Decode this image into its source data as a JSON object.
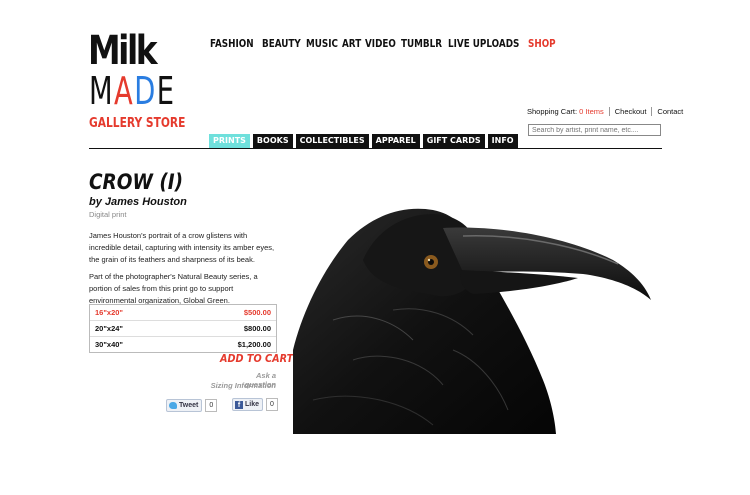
{
  "logo": {
    "line1": "Milk",
    "line2_parts": [
      "M",
      "A",
      "D",
      "E"
    ],
    "subtitle": "GALLERY STORE",
    "colors": {
      "red": "#e53a2d",
      "blue": "#2a7de1"
    }
  },
  "top_nav": {
    "items": [
      {
        "label": "FASHION"
      },
      {
        "label": "BEAUTY"
      },
      {
        "label": "MUSIC"
      },
      {
        "label": "ART"
      },
      {
        "label": "VIDEO"
      },
      {
        "label": "TUMBLR"
      },
      {
        "label": "LIVE UPLOADS"
      },
      {
        "label": "SHOP"
      }
    ],
    "active_index": 7
  },
  "utility": {
    "cart_label": "Shopping Cart:",
    "cart_count": "0 Items",
    "checkout": "Checkout",
    "contact": "Contact"
  },
  "search": {
    "placeholder": "Search by artist, print name, etc...."
  },
  "sub_tabs": {
    "items": [
      "PRINTS",
      "BOOKS",
      "COLLECTIBLES",
      "APPAREL",
      "GIFT CARDS",
      "INFO"
    ],
    "active_index": 0,
    "active_color": "#6fe0dc"
  },
  "product": {
    "title": "CROW (I)",
    "artist": "by James Houston",
    "medium": "Digital print",
    "description_1": "James Houston's portrait of a crow glistens with incredible detail, capturing with intensity its amber eyes, the grain of its feathers and sharpness of its beak.",
    "description_2": "Part of the photographer's Natural Beauty series, a portion of sales from this print go to support environmental organization, Global Green.",
    "sizes": [
      {
        "size": "16\"x20\"",
        "price": "$500.00",
        "selected": true
      },
      {
        "size": "20\"x24\"",
        "price": "$800.00",
        "selected": false
      },
      {
        "size": "30\"x40\"",
        "price": "$1,200.00",
        "selected": false
      }
    ],
    "add_to_cart": "ADD TO CART",
    "ask_question": "Ask a question",
    "sizing_info": "Sizing Information"
  },
  "social": {
    "tweet_label": "Tweet",
    "tweet_count": "0",
    "like_label": "Like",
    "like_count": "0"
  }
}
